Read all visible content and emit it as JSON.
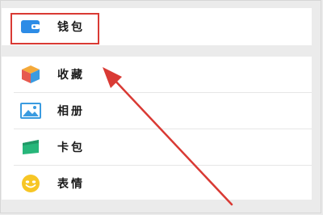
{
  "menu": {
    "top_items": [
      {
        "label": "钱包",
        "icon": "wallet-icon"
      }
    ],
    "list_items": [
      {
        "label": "收藏",
        "icon": "cube-icon"
      },
      {
        "label": "相册",
        "icon": "picture-icon"
      },
      {
        "label": "卡包",
        "icon": "card-icon"
      },
      {
        "label": "表情",
        "icon": "smiley-icon"
      }
    ]
  },
  "colors": {
    "background": "#ebebeb",
    "row_bg": "#ffffff",
    "highlight": "#d93a34",
    "arrow": "#d93a34",
    "wallet": "#2d8ce6",
    "cube_top": "#f4a93a",
    "cube_left": "#e65a4f",
    "cube_right": "#3a9be0",
    "picture": "#3a9be0",
    "card": "#27b67a",
    "smiley": "#f7c625"
  }
}
